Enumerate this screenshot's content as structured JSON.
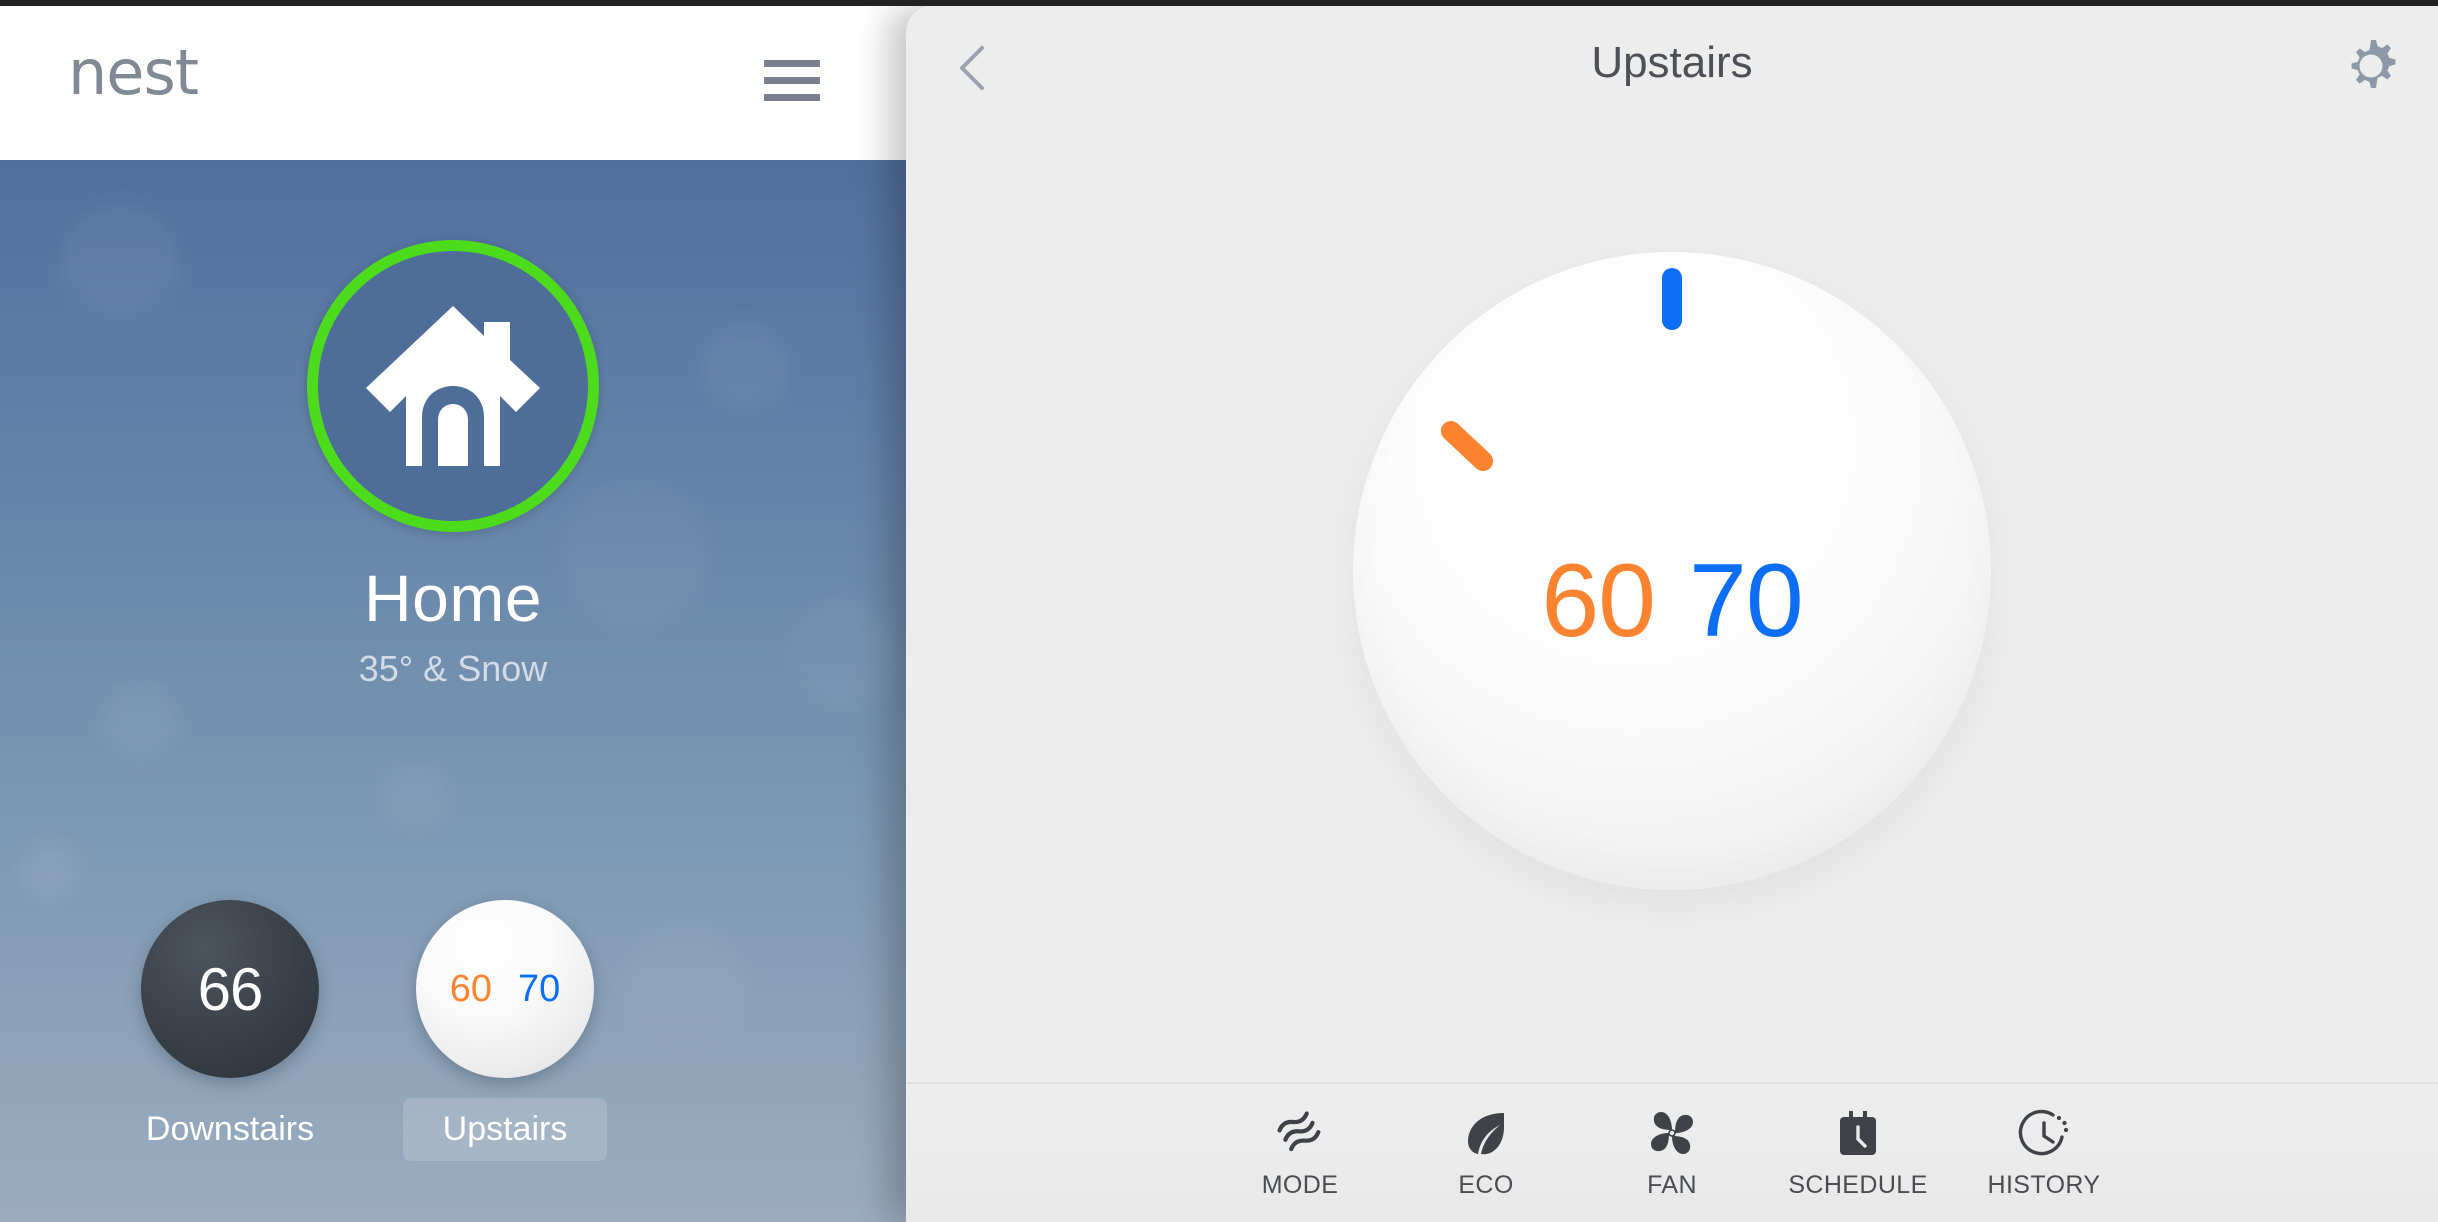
{
  "app": {
    "brand": "nest",
    "menu_icon": "hamburger-menu-icon"
  },
  "left_panel": {
    "structure": {
      "name": "Home",
      "weather": "35° & Snow",
      "icon": "house-icon",
      "ring_color": "#4ddc1c"
    },
    "thermostats": [
      {
        "label": "Downstairs",
        "display_mode": "single",
        "temperature": "66",
        "selected": false,
        "bubble_style": "dark"
      },
      {
        "label": "Upstairs",
        "display_mode": "dual",
        "heat_setpoint": "60",
        "cool_setpoint": "70",
        "selected": true,
        "bubble_style": "light"
      }
    ]
  },
  "right_panel": {
    "header": {
      "back_icon": "back-chevron-icon",
      "title": "Upstairs",
      "settings_icon": "gear-icon"
    },
    "dial": {
      "heat_setpoint": "60",
      "cool_setpoint": "70",
      "heat_color": "#fc8430",
      "cool_color": "#0b6ef5"
    },
    "toolbar": [
      {
        "label": "MODE",
        "icon": "mode-waves-icon"
      },
      {
        "label": "ECO",
        "icon": "eco-leaf-icon"
      },
      {
        "label": "FAN",
        "icon": "fan-blades-icon"
      },
      {
        "label": "SCHEDULE",
        "icon": "schedule-calendar-clock-icon"
      },
      {
        "label": "HISTORY",
        "icon": "history-clock-icon"
      }
    ]
  }
}
